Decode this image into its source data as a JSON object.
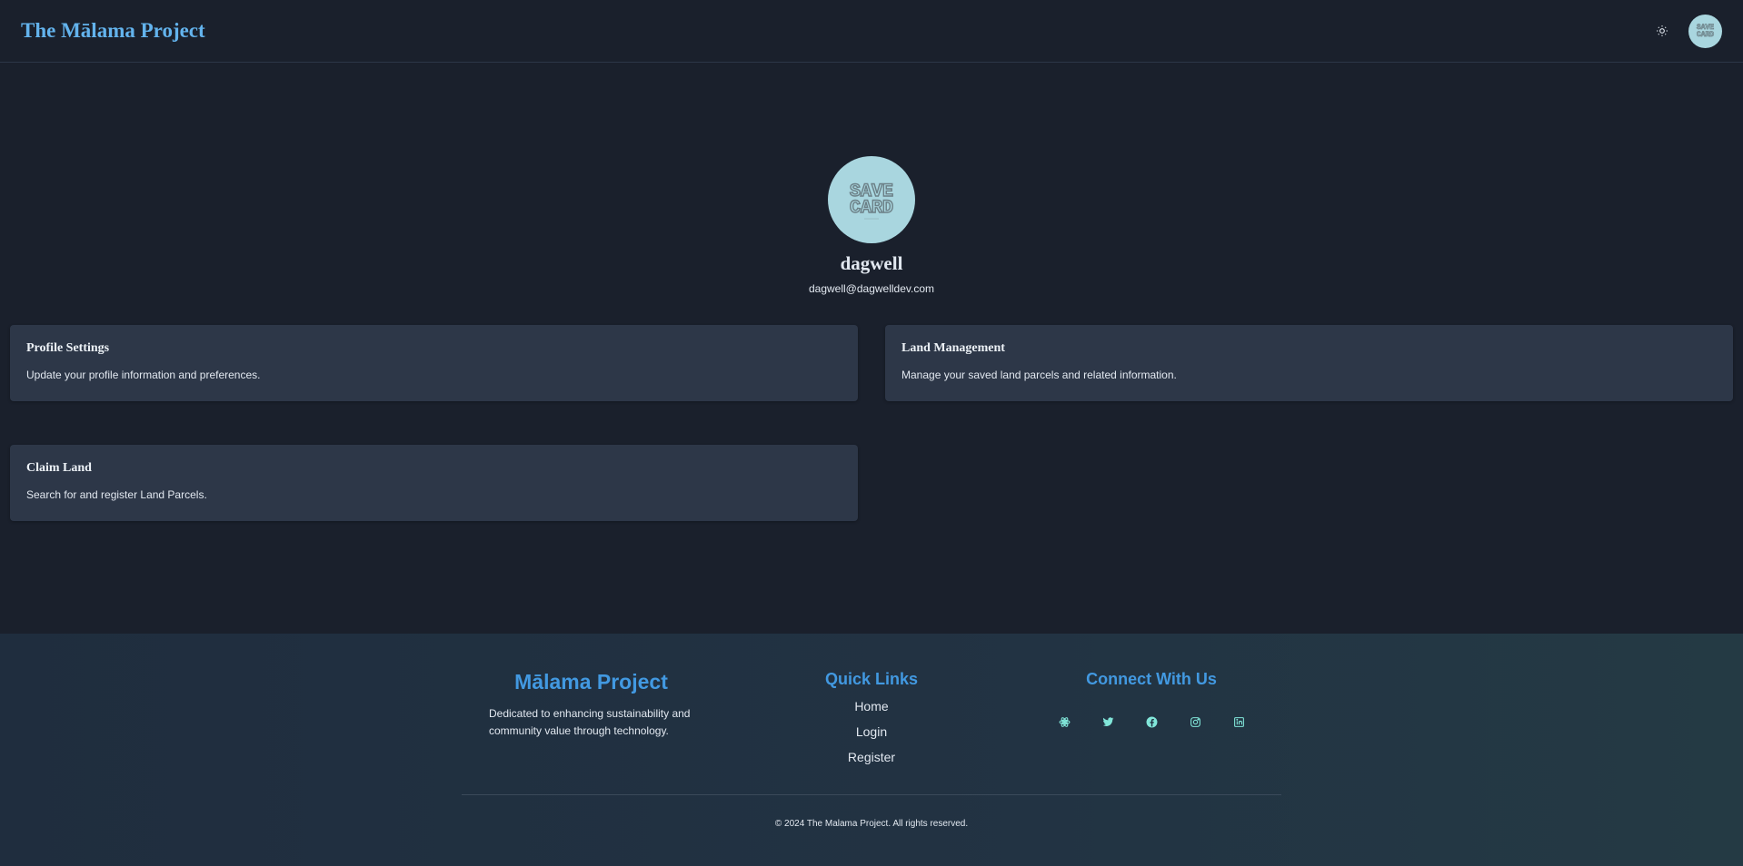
{
  "header": {
    "brand": "The Mālama Project",
    "theme_toggle_icon": "sun-icon",
    "avatar_text": "SAVE CARD"
  },
  "profile": {
    "avatar_text_top": "SAVE",
    "avatar_text_bottom": "CARD",
    "username": "dagwell",
    "email": "dagwell@dagwelldev.com"
  },
  "cards": [
    {
      "title": "Profile Settings",
      "description": "Update your profile information and preferences."
    },
    {
      "title": "Land Management",
      "description": "Manage your saved land parcels and related information."
    },
    {
      "title": "Claim Land",
      "description": "Search for and register Land Parcels."
    }
  ],
  "footer": {
    "about_title": "Mālama Project",
    "about_text": "Dedicated to enhancing sustainability and community value through technology.",
    "links_title": "Quick Links",
    "links": [
      "Home",
      "Login",
      "Register"
    ],
    "social_title": "Connect With Us",
    "social_icons": [
      "react-icon",
      "twitter-icon",
      "facebook-icon",
      "instagram-icon",
      "linkedin-icon"
    ],
    "copyright": "© 2024 The Malama Project. All rights reserved."
  },
  "colors": {
    "background": "#1a202c",
    "card": "#2d3748",
    "accent": "#63b3ed",
    "footer_title": "#4299e1",
    "social": "#81e6d9"
  }
}
